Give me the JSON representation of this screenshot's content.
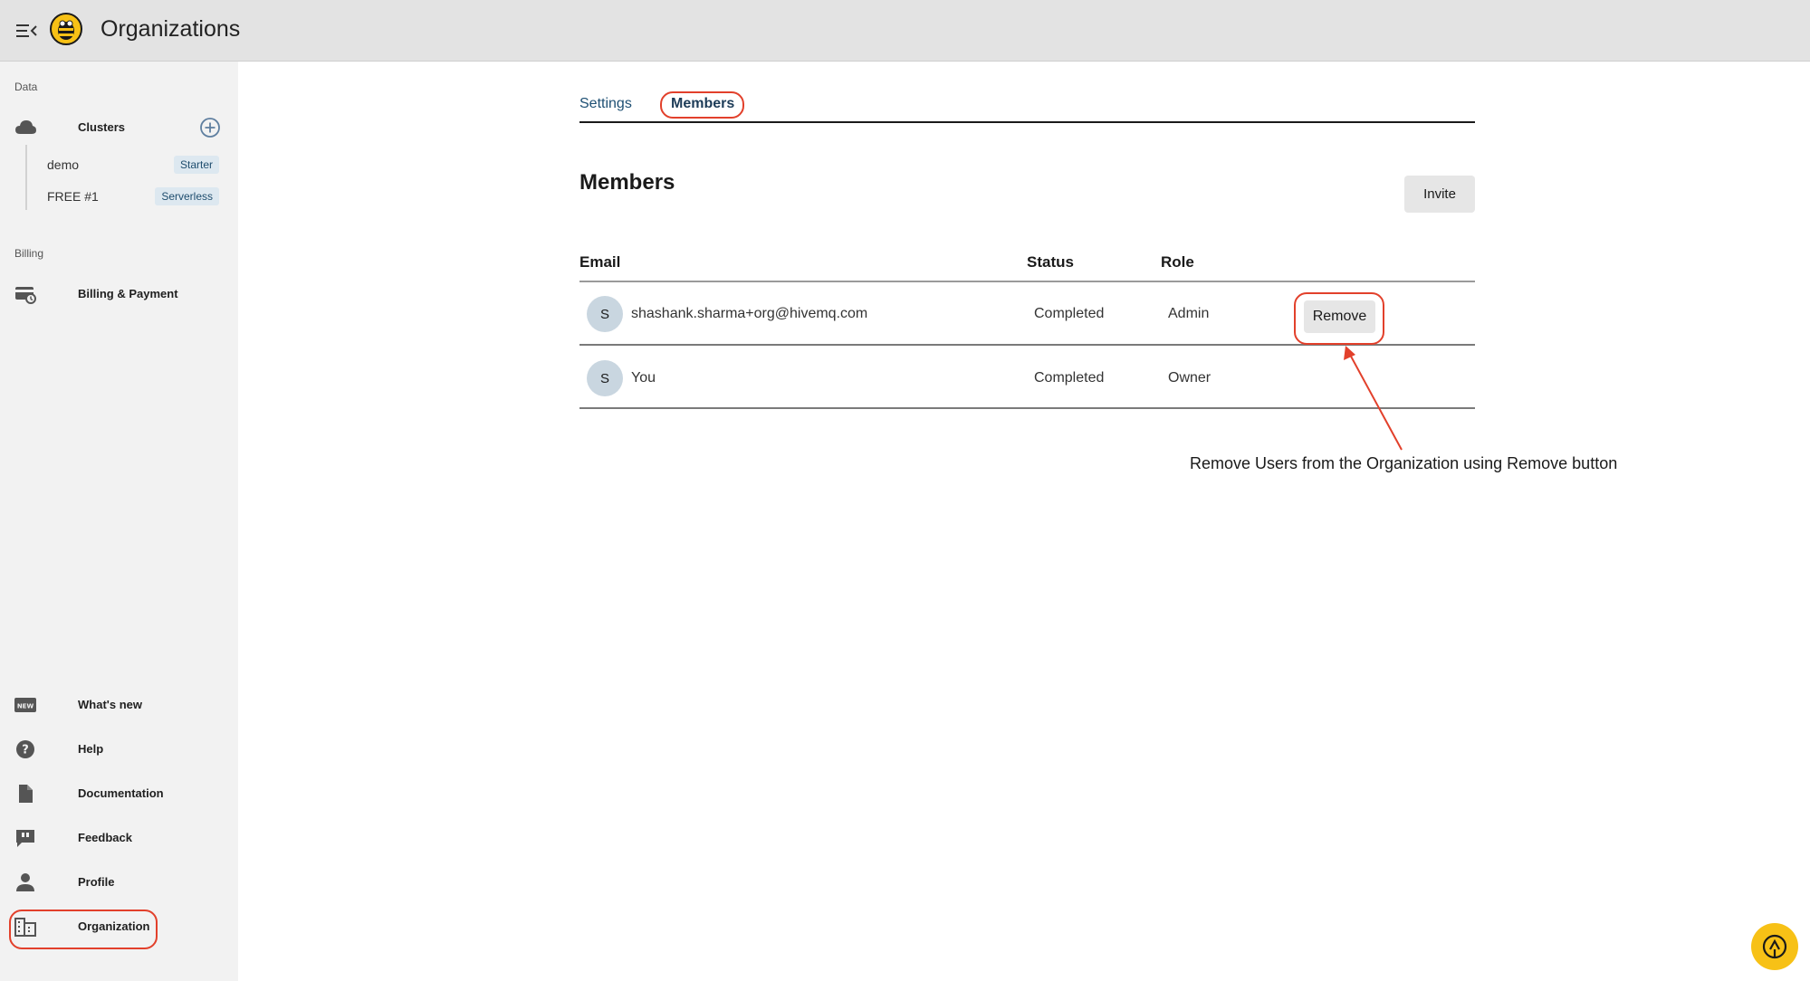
{
  "header": {
    "title": "Organizations",
    "menu_icon": "menu-collapse-icon",
    "logo_icon": "bee-logo-icon"
  },
  "sidebar": {
    "sections": {
      "data": "Data",
      "billing": "Billing"
    },
    "clusters": {
      "label": "Clusters",
      "icon": "cloud-icon",
      "add_icon": "add-circle-icon",
      "items": [
        {
          "name": "demo",
          "badge": "Starter"
        },
        {
          "name": "FREE #1",
          "badge": "Serverless"
        }
      ]
    },
    "billing_item": {
      "label": "Billing & Payment",
      "icon": "billing-icon"
    },
    "bottom_items": [
      {
        "label": "What's new",
        "icon": "new-badge-icon"
      },
      {
        "label": "Help",
        "icon": "help-circle-icon"
      },
      {
        "label": "Documentation",
        "icon": "document-icon"
      },
      {
        "label": "Feedback",
        "icon": "feedback-icon"
      },
      {
        "label": "Profile",
        "icon": "person-icon"
      },
      {
        "label": "Organization",
        "icon": "organization-icon"
      }
    ]
  },
  "tabs": [
    {
      "label": "Settings"
    },
    {
      "label": "Members",
      "active": true
    }
  ],
  "members": {
    "title": "Members",
    "invite_label": "Invite",
    "columns": {
      "email": "Email",
      "status": "Status",
      "role": "Role"
    },
    "rows": [
      {
        "initial": "S",
        "email": "shashank.sharma+org@hivemq.com",
        "status": "Completed",
        "role": "Admin",
        "action": "Remove"
      },
      {
        "initial": "S",
        "email": "You",
        "status": "Completed",
        "role": "Owner"
      }
    ]
  },
  "annotation": {
    "text": "Remove Users  from the Organization using Remove button",
    "color": "#e2402b"
  },
  "help_fab_icon": "support-icon",
  "colors": {
    "accent": "#f7c116",
    "link": "#1d4f73",
    "highlight": "#e2402b",
    "badge_bg": "#dde8f0"
  }
}
